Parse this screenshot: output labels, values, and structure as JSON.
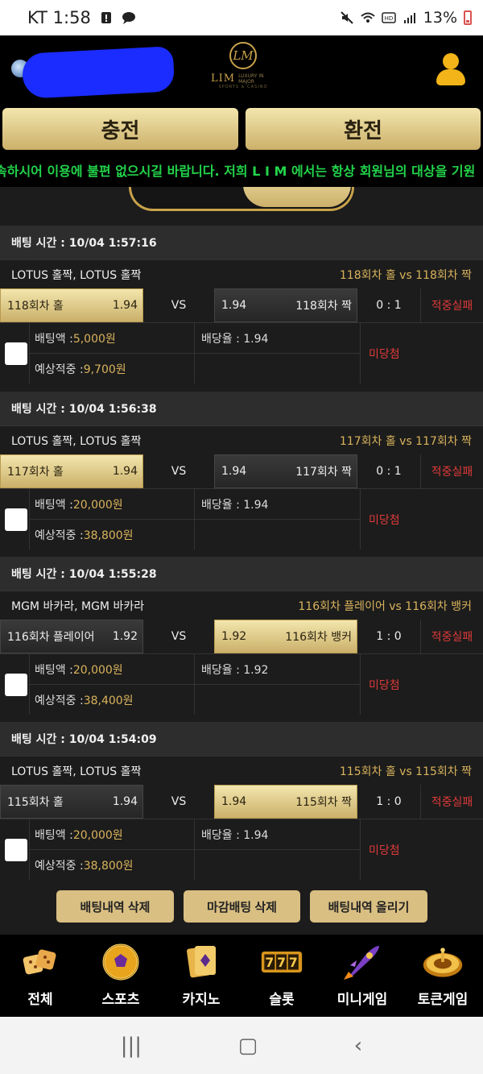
{
  "status_bar": {
    "carrier_time": "KT 1:58",
    "battery": "13%"
  },
  "header": {
    "logo_name": "LIM",
    "logo_tag": "LUXURY IN MAJOR",
    "logo_sub": "SPORTS & CASINO",
    "logo_mark": "LM"
  },
  "actions": {
    "charge": "충전",
    "exchange": "환전"
  },
  "marquee": "속하시어 이용에 불편 없으시길 바랍니다. 저희 L I M 에서는 항상 회원님의 대상을 기원",
  "bets": [
    {
      "time": "배팅 시간 : 10/04 1:57:16",
      "game": "LOTUS 홀짝, LOTUS 홀짝",
      "match": "118회차 홀  vs  118회차 짝",
      "left_label": "118회차 홀",
      "left_odds": "1.94",
      "left_selected": true,
      "vs": "VS",
      "right_label": "118회차 짝",
      "right_odds": "1.94",
      "right_selected": false,
      "score": "0 : 1",
      "result": "적중실패",
      "bet_amount_label": "배팅액 : ",
      "bet_amount": "5,000원",
      "expected_label": "예상적중 : ",
      "expected": "9,700원",
      "rate_label": "배당율 : 1.94",
      "status": "미당첨"
    },
    {
      "time": "배팅 시간 : 10/04 1:56:38",
      "game": "LOTUS 홀짝, LOTUS 홀짝",
      "match": "117회차 홀  vs  117회차 짝",
      "left_label": "117회차 홀",
      "left_odds": "1.94",
      "left_selected": true,
      "vs": "VS",
      "right_label": "117회차 짝",
      "right_odds": "1.94",
      "right_selected": false,
      "score": "0 : 1",
      "result": "적중실패",
      "bet_amount_label": "배팅액 : ",
      "bet_amount": "20,000원",
      "expected_label": "예상적중 : ",
      "expected": "38,800원",
      "rate_label": "배당율 : 1.94",
      "status": "미당첨"
    },
    {
      "time": "배팅 시간 : 10/04 1:55:28",
      "game": "MGM 바카라, MGM 바카라",
      "match": "116회차 플레이어  vs  116회차 뱅커",
      "left_label": "116회차 플레이어",
      "left_odds": "1.92",
      "left_selected": false,
      "vs": "VS",
      "right_label": "116회차 뱅커",
      "right_odds": "1.92",
      "right_selected": true,
      "score": "1 : 0",
      "result": "적중실패",
      "bet_amount_label": "배팅액 : ",
      "bet_amount": "20,000원",
      "expected_label": "예상적중 : ",
      "expected": "38,400원",
      "rate_label": "배당율 : 1.92",
      "status": "미당첨"
    },
    {
      "time": "배팅 시간 : 10/04 1:54:09",
      "game": "LOTUS 홀짝, LOTUS 홀짝",
      "match": "115회차 홀  vs  115회차 짝",
      "left_label": "115회차 홀",
      "left_odds": "1.94",
      "left_selected": false,
      "vs": "VS",
      "right_label": "115회차 짝",
      "right_odds": "1.94",
      "right_selected": true,
      "score": "1 : 0",
      "result": "적중실패",
      "bet_amount_label": "배팅액 : ",
      "bet_amount": "20,000원",
      "expected_label": "예상적중 : ",
      "expected": "38,800원",
      "rate_label": "배당율 : 1.94",
      "status": "미당첨"
    }
  ],
  "bottom_actions": {
    "delete_history": "배팅내역 삭제",
    "delete_closed": "마감배팅 삭제",
    "upload_history": "배팅내역 올리기"
  },
  "nav": [
    {
      "label": "전체",
      "icon": "dice-icon"
    },
    {
      "label": "스포츠",
      "icon": "soccer-ball-icon"
    },
    {
      "label": "카지노",
      "icon": "cards-icon"
    },
    {
      "label": "슬롯",
      "icon": "slot-777-icon"
    },
    {
      "label": "미니게임",
      "icon": "rocket-icon"
    },
    {
      "label": "토큰게임",
      "icon": "roulette-icon"
    }
  ],
  "colors": {
    "gold": "#cbb06a",
    "fail_red": "#e03a3a",
    "marquee_green": "#22d44a",
    "amount_gold": "#d9b35c"
  }
}
